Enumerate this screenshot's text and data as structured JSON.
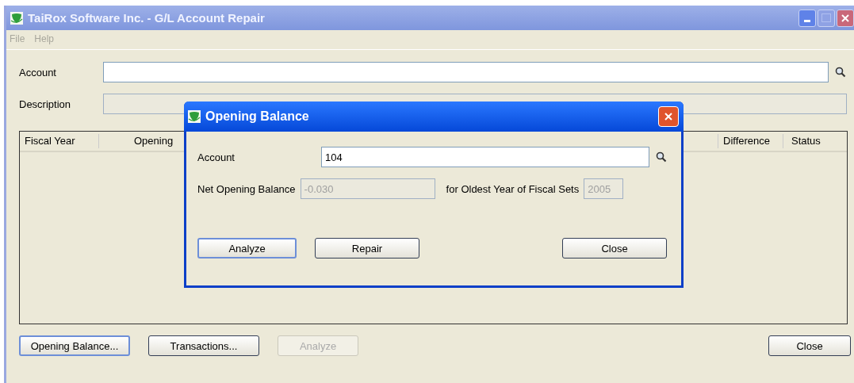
{
  "window": {
    "title": "TaiRox Software Inc. - G/L Account Repair",
    "active": false
  },
  "menu": [
    {
      "label": "File",
      "disabled": true
    },
    {
      "label": "Help",
      "disabled": true
    }
  ],
  "fields": [
    {
      "label": "Account",
      "disabled": false,
      "lookup": true
    },
    {
      "label": "Description",
      "disabled": true,
      "lookup": false
    }
  ],
  "table": {
    "columns": [
      "Fiscal Year",
      "Opening",
      "Difference",
      "Status"
    ]
  },
  "buttons": [
    {
      "label": "Opening Balance...",
      "focused": true,
      "disabled": false
    },
    {
      "label": "Transactions...",
      "focused": false,
      "disabled": false
    },
    {
      "label": "Analyze",
      "focused": false,
      "disabled": true
    },
    {
      "label": "Close",
      "focused": false,
      "disabled": false
    }
  ],
  "dialog": {
    "title": "Opening Balance",
    "active": true,
    "account": {
      "label": "Account",
      "value": "104"
    },
    "net_opening_balance": {
      "label": "Net Opening Balance",
      "value": "-0.030",
      "disabled": true
    },
    "oldest_year": {
      "label": "for Oldest Year of Fiscal Sets",
      "value": "2005",
      "disabled": true
    },
    "buttons": [
      {
        "label": "Analyze",
        "focused": true,
        "disabled": false
      },
      {
        "label": "Repair",
        "focused": false,
        "disabled": false
      },
      {
        "label": "Close",
        "focused": false,
        "disabled": false
      }
    ]
  }
}
